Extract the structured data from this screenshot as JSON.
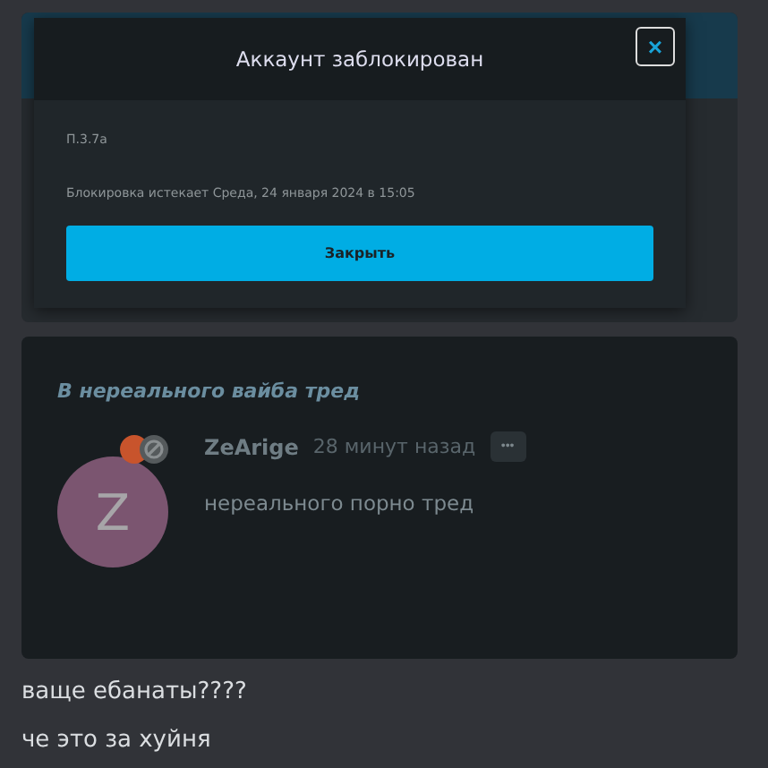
{
  "modal": {
    "title": "Аккаунт заблокирован",
    "close_icon": "×",
    "rule": "П.3.7а",
    "expires": "Блокировка истекает Среда, 24 января 2024 в 15:05",
    "button": "Закрыть"
  },
  "embed": {
    "title": "В нереального вайба тред",
    "avatar_letter": "Z",
    "author": "ZeArige",
    "time": "28 минут назад",
    "more": "•••",
    "message": "нереального порно тред"
  },
  "messages": [
    "ваще ебанаты????",
    "че это за хуйня"
  ]
}
